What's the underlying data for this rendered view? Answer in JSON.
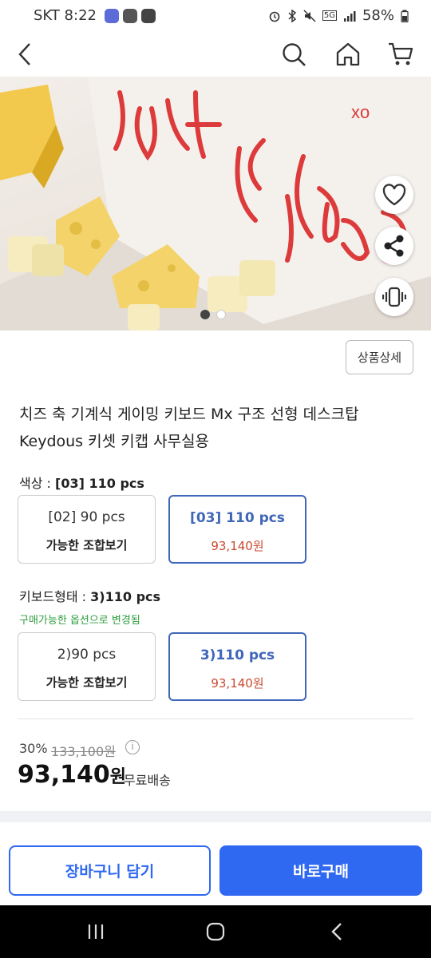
{
  "status_bar": {
    "carrier_time": "SKT 8:22",
    "battery": "58%",
    "network": "5G"
  },
  "app_bar": {
    "icons": [
      "back-icon",
      "search-icon",
      "home-icon",
      "cart-icon"
    ]
  },
  "hero": {
    "side_actions": [
      "heart-icon",
      "share-icon",
      "vibrate-icon"
    ],
    "page_index": 1,
    "page_count": 2
  },
  "detail_button": "상품상세",
  "product": {
    "title_line1": "치즈 축 기계식 게이밍 키보드 Mx 구조 선형 데스크탑",
    "title_line2": "Keydous 키셋 키캡 사무실용"
  },
  "color_option": {
    "label": "색상 : ",
    "selected": "[03] 110 pcs",
    "choices": [
      {
        "name": "[02] 90 pcs",
        "sub": "가능한 조합보기"
      },
      {
        "name": "[03] 110 pcs",
        "sub": "93,140원"
      }
    ]
  },
  "shape_option": {
    "label": "키보드형태 : ",
    "selected": "3)110 pcs",
    "notice": "구매가능한 옵션으로 변경됨",
    "choices": [
      {
        "name": "2)90 pcs",
        "sub": "가능한 조합보기"
      },
      {
        "name": "3)110 pcs",
        "sub": "93,140원"
      }
    ]
  },
  "price": {
    "discount": "30%",
    "original": "133,100원",
    "info_icon": "i",
    "current": "93,140",
    "unit": "원",
    "shipping": "무료배송"
  },
  "buttons": {
    "cart": "장바구니 담기",
    "buy": "바로구매"
  },
  "colors": {
    "accent": "#2f68f1",
    "selected_border": "#3f66b8",
    "price_red": "#c94a2f",
    "notice_green": "#2e9e3e"
  }
}
